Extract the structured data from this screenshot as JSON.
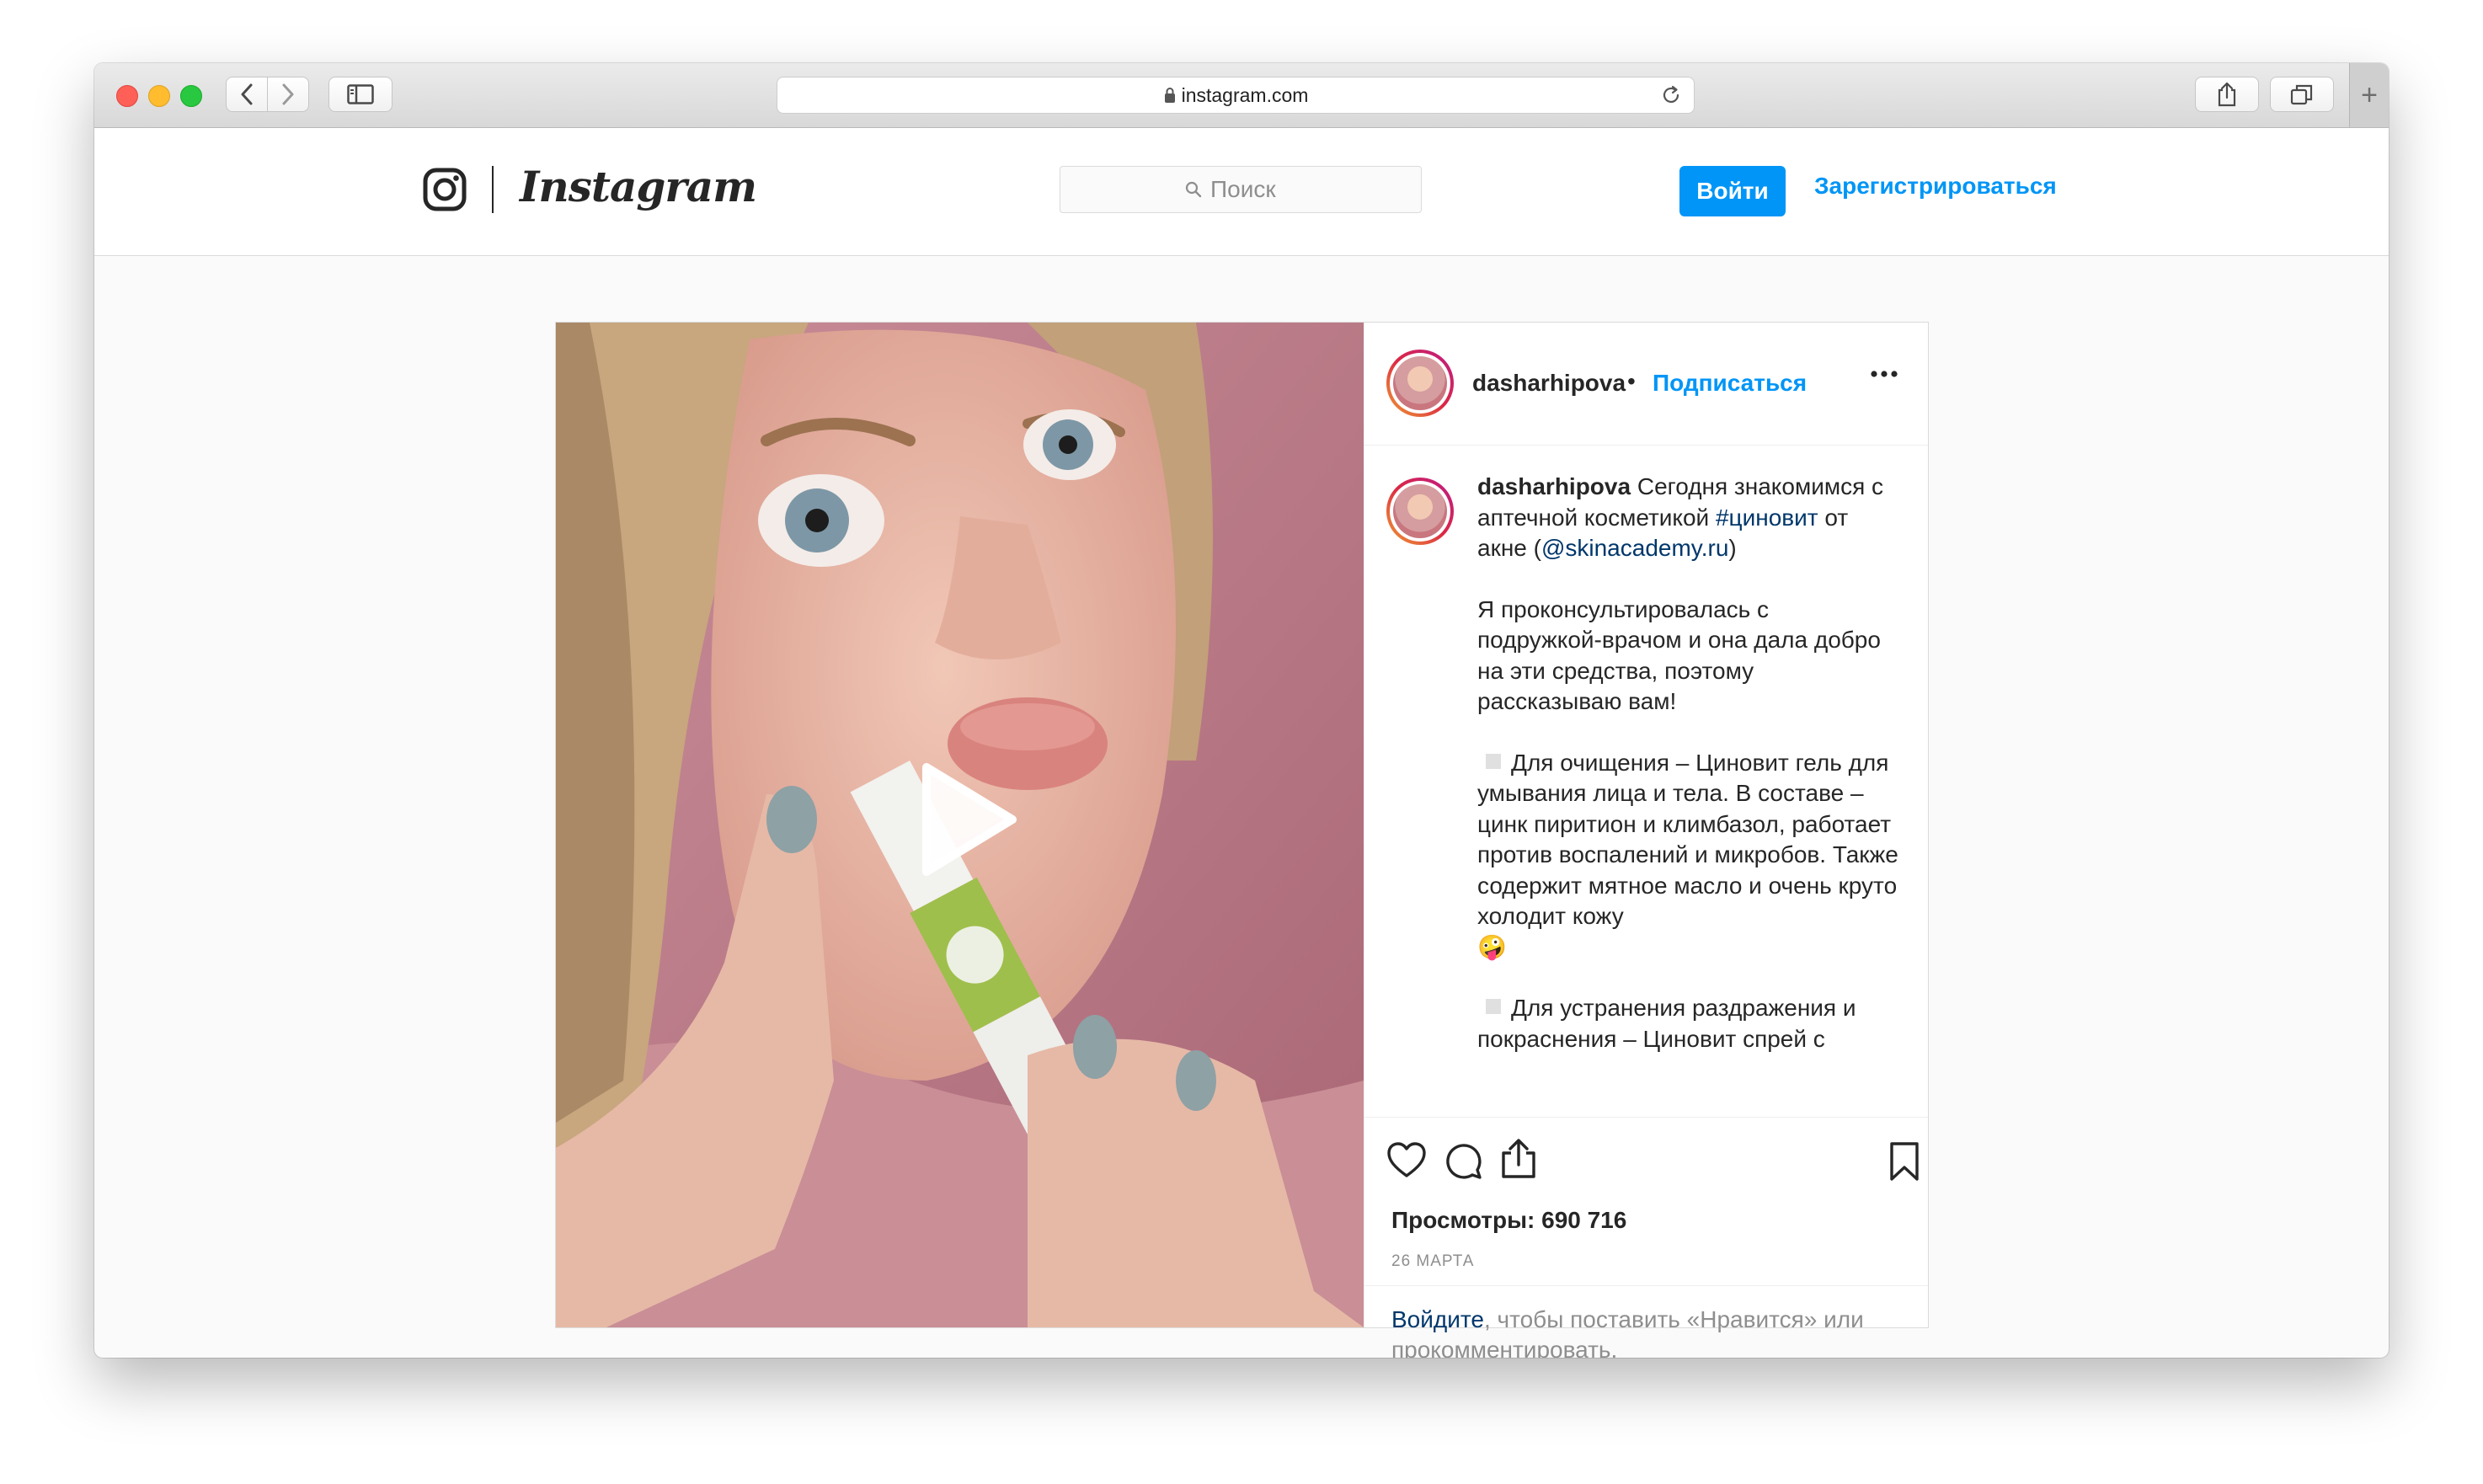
{
  "browser": {
    "url": "instagram.com"
  },
  "header": {
    "logo_text": "Instagram",
    "search_placeholder": "Поиск",
    "login_button": "Войти",
    "signup_link": "Зарегистрироваться"
  },
  "post": {
    "username": "dasharhipova",
    "follow_label": "Подписаться",
    "dot": "•",
    "caption": {
      "username": "dasharhipova",
      "intro_part1": " Сегодня знакомимся с аптечной косметикой ",
      "hashtag": "#циновит",
      "intro_part2": " от акне (",
      "mention": "@skinacademy.ru",
      "intro_part3": ")",
      "paragraph2": "Я проконсультировалась с подружкой-врачом и она дала добро на эти средства, поэтому рассказываю вам!",
      "paragraph3": "Для очищения – Циновит гель для умывания лица и тела. В составе – цинк пиритион и климбазол, работает против воспалений и микробов. Также содержит мятное масло и очень круто холодит кожу",
      "emoji": "🤪",
      "paragraph4": "Для устранения раздражения и покраснения – Циновит спрей с"
    },
    "views": "Просмотры: 690 716",
    "date": "26 МАРТА",
    "login_prompt_link": "Войдите",
    "login_prompt_text": ", чтобы поставить «Нравится» или прокомментировать."
  },
  "icons": {
    "lock": "lock-icon",
    "reload": "reload-icon",
    "search": "search-icon",
    "like": "heart-icon",
    "comment": "comment-icon",
    "share": "share-icon",
    "save": "bookmark-icon",
    "more": "more-icon",
    "play": "play-icon"
  },
  "colors": {
    "accent_blue": "#0095f6",
    "link_dark": "#00376b",
    "text": "#262626",
    "muted": "#8e8e8e"
  }
}
